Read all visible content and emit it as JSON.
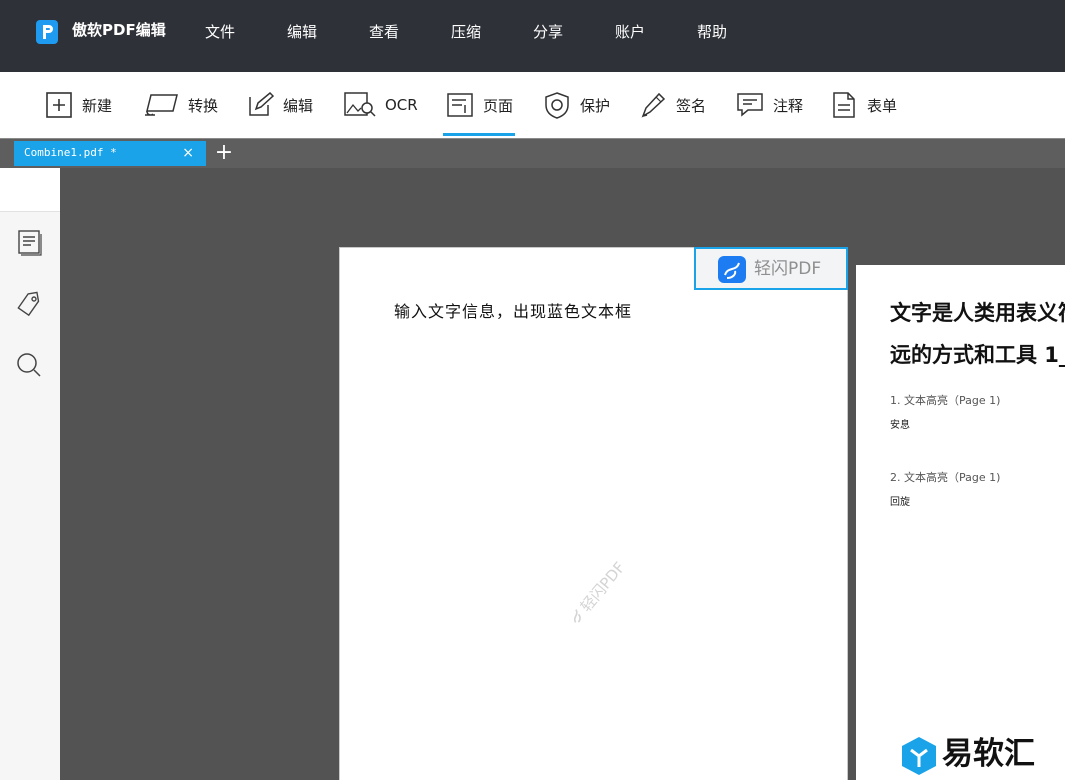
{
  "app": {
    "title": "傲软PDF编辑",
    "menu": [
      "文件",
      "编辑",
      "查看",
      "压缩",
      "分享",
      "账户",
      "帮助"
    ]
  },
  "toolbar": {
    "items": [
      {
        "label": "新建",
        "icon": "plus-box-icon"
      },
      {
        "label": "转换",
        "icon": "convert-icon"
      },
      {
        "label": "编辑",
        "icon": "edit-icon"
      },
      {
        "label": "OCR",
        "icon": "ocr-icon"
      },
      {
        "label": "页面",
        "icon": "page-icon",
        "active": true
      },
      {
        "label": "保护",
        "icon": "shield-icon"
      },
      {
        "label": "签名",
        "icon": "pen-icon"
      },
      {
        "label": "注释",
        "icon": "comment-icon"
      },
      {
        "label": "表单",
        "icon": "form-icon"
      }
    ],
    "accent": "#1aa3e8"
  },
  "tabs": {
    "document": "Combine1.pdf *",
    "close": "×",
    "add": "+"
  },
  "sidebar": {
    "icons": [
      "thumbnails-icon",
      "tag-icon",
      "search-icon"
    ]
  },
  "page1": {
    "text": "输入文字信息，出现蓝色文本框",
    "watermark": "轻闪PDF"
  },
  "brand_badge": {
    "text": "轻闪PDF"
  },
  "page2": {
    "heading_line1": "文字是人类用表义符",
    "heading_line2": "远的方式和工具 1_",
    "items": [
      {
        "title": "1. 文本高亮（Page 1)",
        "note": "安息"
      },
      {
        "title": "2. 文本高亮（Page 1)",
        "note": "回旋"
      }
    ]
  },
  "site_logo": {
    "text": "易软汇"
  }
}
